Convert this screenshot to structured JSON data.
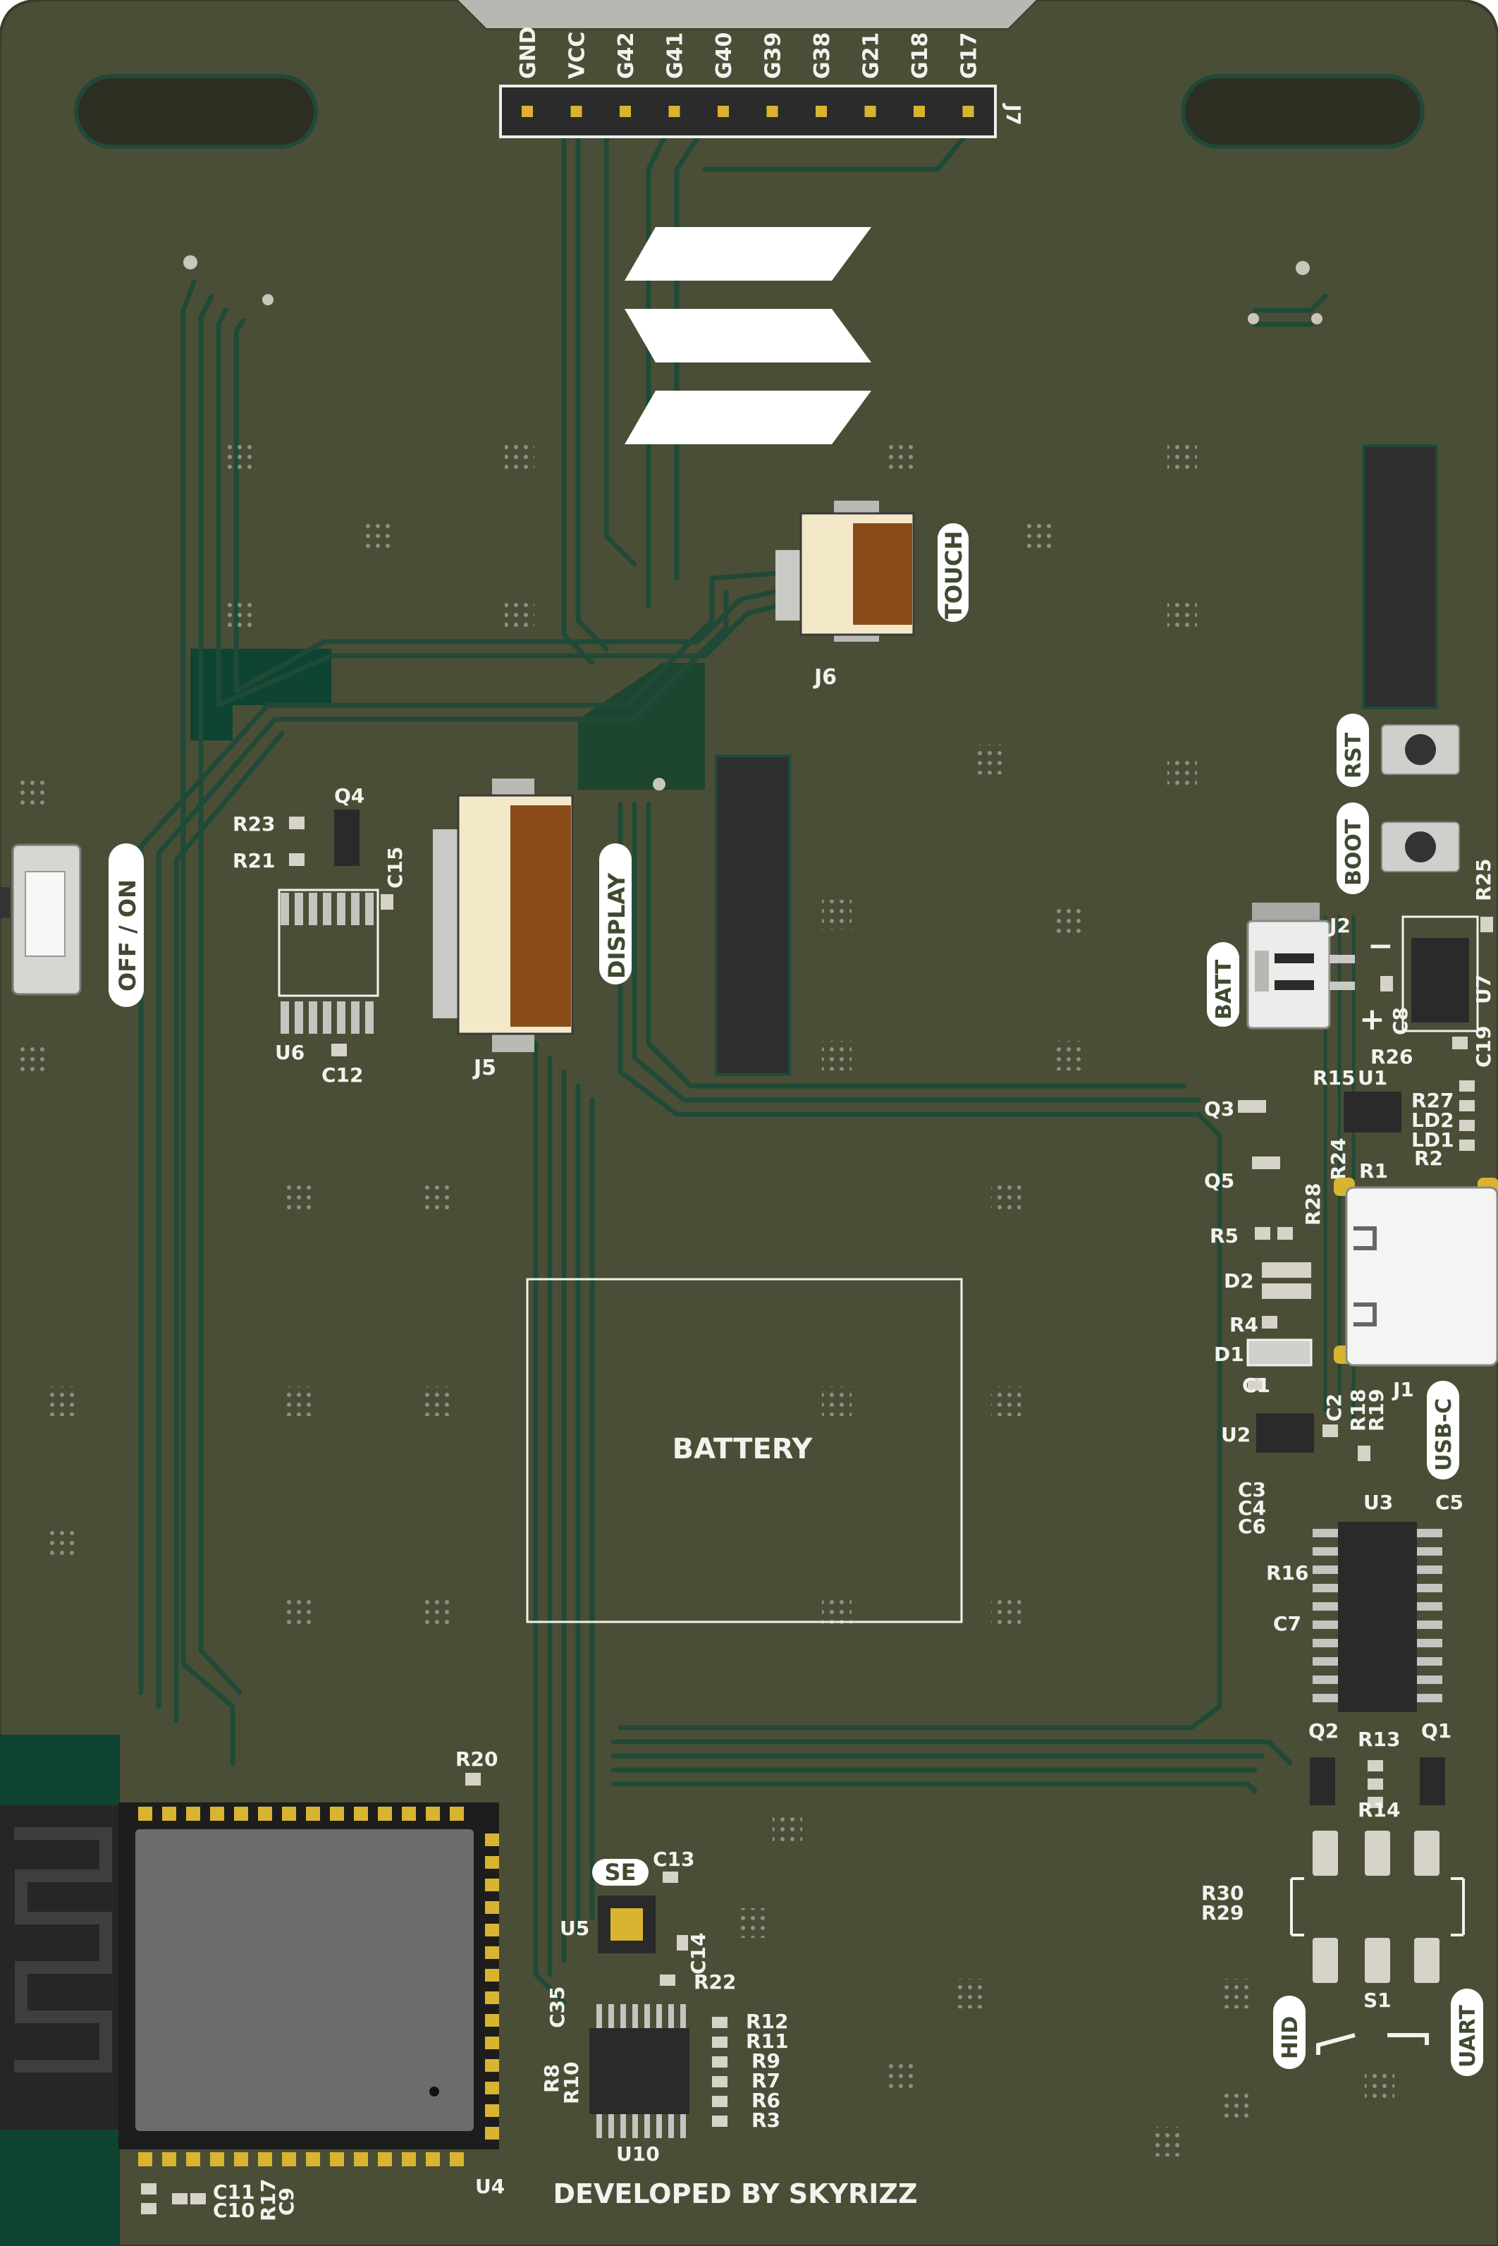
{
  "colors": {
    "board": "#4b4e36",
    "copper_pour": "#0f4332",
    "trace": "#1f4a37",
    "silkscreen": "#f2f2ee",
    "chip": "#2a2a2a",
    "pad": "#d6d3c8",
    "connector_body": "#f3e9c8",
    "connector_latch": "#8a4b1a",
    "gold": "#d8b431"
  },
  "header": {
    "ref": "J7",
    "pins": [
      "GND",
      "VCC",
      "G42",
      "G41",
      "G40",
      "G39",
      "G38",
      "G21",
      "G18",
      "G17"
    ]
  },
  "labels": {
    "touch": "TOUCH",
    "display": "DISPLAY",
    "off_on": "OFF / ON",
    "battery": "BATTERY",
    "batt": "BATT",
    "rst": "RST",
    "boot": "BOOT",
    "usb_c": "USB-C",
    "se": "SE",
    "hid": "HID",
    "uart": "UART",
    "credit": "DEVELOPED BY SKYRIZZ",
    "plus": "+",
    "minus": "−"
  },
  "refs": {
    "j6": "J6",
    "j5": "J5",
    "j2": "J2",
    "j1": "J1",
    "q4": "Q4",
    "r23": "R23",
    "r21": "R21",
    "c15": "C15",
    "u6": "U6",
    "c12": "C12",
    "r25": "R25",
    "u7": "U7",
    "c8": "C8",
    "r26": "R26",
    "c19": "C19",
    "r15": "R15",
    "u1": "U1",
    "q3": "Q3",
    "r27": "R27",
    "ld2": "LD2",
    "ld1": "LD1",
    "r24": "R24",
    "r1": "R1",
    "r2": "R2",
    "q5": "Q5",
    "r28": "R28",
    "r5": "R5",
    "d2": "D2",
    "r4": "R4",
    "d1": "D1",
    "c1": "C1",
    "c2": "C2",
    "r18": "R18",
    "r19": "R19",
    "u2": "U2",
    "c3": "C3",
    "c4": "C4",
    "c6": "C6",
    "u3": "U3",
    "c5": "C5",
    "r16": "R16",
    "c7": "C7",
    "q2": "Q2",
    "r13": "R13",
    "q1": "Q1",
    "r14": "R14",
    "r30": "R30",
    "r29": "R29",
    "s1": "S1",
    "r20": "R20",
    "c13": "C13",
    "u5": "U5",
    "c14": "C14",
    "r22": "R22",
    "c35": "C35",
    "r8": "R8",
    "r10": "R10",
    "r12": "R12",
    "r11": "R11",
    "r9": "R9",
    "r7": "R7",
    "r6": "R6",
    "r3": "R3",
    "u10": "U10",
    "u4": "U4",
    "c11": "C11",
    "c10": "C10",
    "r17": "R17",
    "c9": "C9"
  }
}
